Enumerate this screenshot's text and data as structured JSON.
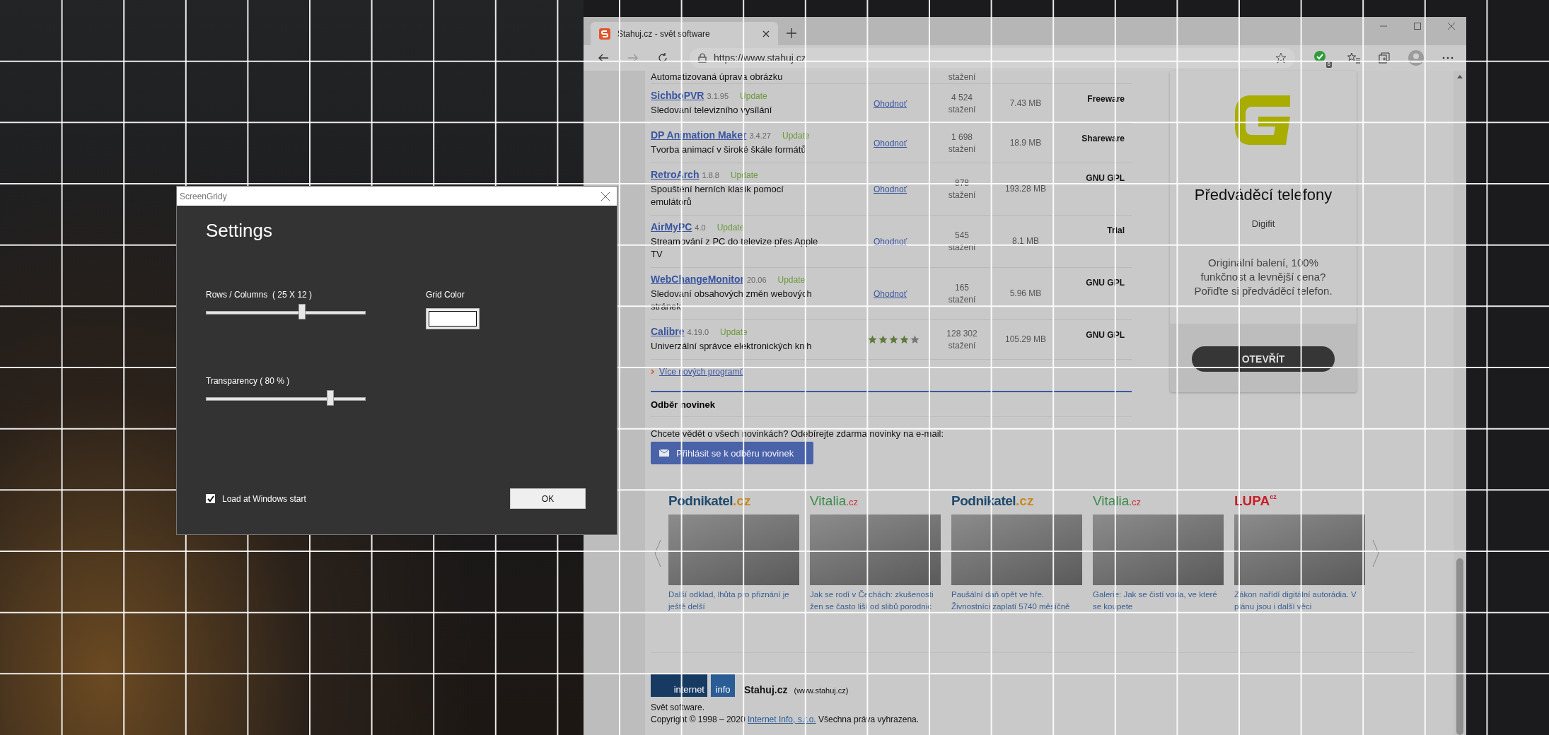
{
  "dialog": {
    "title": "ScreenGridy",
    "heading": "Settings",
    "sliders": [
      {
        "label": "Rows / Columns  ( 25 X 12 )",
        "level": 0.6
      },
      {
        "label": "Transparency ( 80 % )",
        "level": 0.78
      }
    ],
    "grid_color": {
      "label": "Grid Color"
    },
    "load_at_start": {
      "label": "Load at Windows start",
      "checked": true
    },
    "ok_button": "OK"
  },
  "browser": {
    "tab_title": "Stahuj.cz - svět software",
    "url": "https://www.stahuj.cz",
    "extension_badge": "6",
    "partial_row": {
      "description": "Automatizovaná úprava obrázku",
      "downloads_unit": "stažení"
    },
    "programs": [
      {
        "name": "SichboPVR",
        "version": "3.1.95",
        "status": "Update",
        "description": "Sledování televizního vysílání",
        "rating": {
          "kind": "link",
          "text": "Ohodnoť"
        },
        "downloads": "4 524",
        "downloads_unit": "stažení",
        "size": "7.43 MB",
        "license": "Freeware"
      },
      {
        "name": "DP Animation Maker",
        "version": "3.4.27",
        "status": "Update",
        "description": "Tvorba animací v široké škále formátů",
        "rating": {
          "kind": "link",
          "text": "Ohodnoť"
        },
        "downloads": "1 698",
        "downloads_unit": "stažení",
        "size": "18.9 MB",
        "license": "Shareware"
      },
      {
        "name": "RetroArch",
        "version": "1.8.8",
        "status": "Update",
        "description": "Spouštění herních klasik pomocí emulátorů",
        "rating": {
          "kind": "link",
          "text": "Ohodnoť"
        },
        "downloads": "878",
        "downloads_unit": "stažení",
        "size": "193.28 MB",
        "license": "GNU GPL"
      },
      {
        "name": "AirMyPC",
        "version": "4.0",
        "status": "Update",
        "description": "Streamování z PC do televize přes Apple TV",
        "rating": {
          "kind": "link",
          "text": "Ohodnoť"
        },
        "downloads": "545",
        "downloads_unit": "stažení",
        "size": "8.1 MB",
        "license": "Trial"
      },
      {
        "name": "WebChangeMonitor",
        "version": "20.06",
        "status": "Update",
        "description": "Sledování obsahových změn webových stránek",
        "rating": {
          "kind": "link",
          "text": "Ohodnoť"
        },
        "downloads": "165",
        "downloads_unit": "stažení",
        "size": "5.96 MB",
        "license": "GNU GPL"
      },
      {
        "name": "Calibre",
        "version": "4.19.0",
        "status": "Update",
        "description": "Univerzální správce elektronických knih",
        "rating": {
          "kind": "stars",
          "stars": 4
        },
        "downloads": "128 302",
        "downloads_unit": "stažení",
        "size": "105.29 MB",
        "license": "GNU GPL"
      }
    ],
    "more_link": "Více nových programů",
    "newsletter": {
      "heading": "Odběr novinek",
      "text": "Chcete vědět o všech novinkách? Odebírejte zdarma novinky na e-mail:",
      "button": "Přihlásit se k odběru novinek"
    },
    "carousel": [
      {
        "kind": "podnikatel",
        "logo": "Podnikatel",
        "logo_suffix": ".cz",
        "caption": "Další odklad, lhůta pro přiznání je ještě delší"
      },
      {
        "kind": "vitalia",
        "logo": "Vitalia",
        "logo_suffix": ".cz",
        "caption": "Jak se rodí v Čechách: zkušenosti žen se často liší od slibů porodnic"
      },
      {
        "kind": "podnikatel",
        "logo": "Podnikatel",
        "logo_suffix": ".cz",
        "caption": "Paušální daň opět ve hře. Živnostníci zaplatí 5740 měsíčně"
      },
      {
        "kind": "vitalia",
        "logo": "Vitalia",
        "logo_suffix": ".cz",
        "caption": "Galerie: Jak se čistí voda, ve které se koupete"
      },
      {
        "kind": "lupa",
        "logo": "LUPA",
        "logo_suffix": "cz",
        "caption": "Zákon nařídí digitální autorádia. V plánu jsou i další věci"
      }
    ],
    "footer": {
      "logo_left": "internet",
      "logo_right": "info",
      "site": "Stahuj.cz",
      "site_url": "(www.stahuj.cz)",
      "tagline": "Svět software.",
      "copyright_before": "Copyright © 1998 – 2020 ",
      "copyright_link": "Internet Info, s.r.o.",
      "copyright_after": " Všechna práva vyhrazena."
    },
    "ad": {
      "heading": "Předváděcí telefony",
      "brand": "Digifit",
      "text": "Originální balení, 100% funkčnost a levnější cena? Pořiďte si předváděcí telefon.",
      "button": "OTEVŘÍT"
    }
  }
}
